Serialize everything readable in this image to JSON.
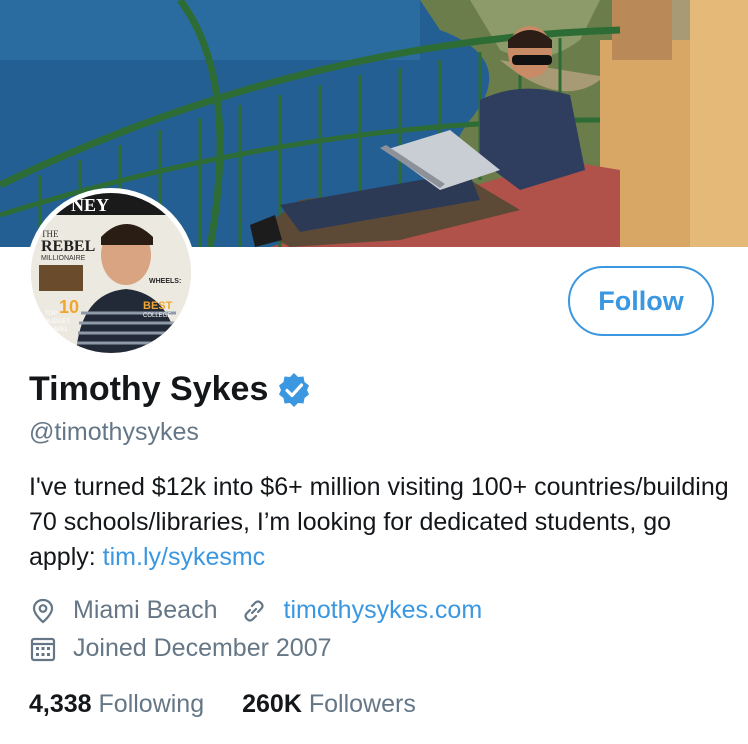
{
  "profile": {
    "name": "Timothy Sykes",
    "handle": "@timothysykes",
    "follow_label": "Follow",
    "bio_text": "I've turned $12k into $6+ million visiting 100+ countries/building 70 schools/libraries, I’m looking for dedicated students, go apply: ",
    "bio_link": "tim.ly/sykesmc",
    "location": "Miami Beach",
    "website": "timothysykes.com",
    "joined": "Joined December 2007",
    "following_count": "4,338",
    "following_label": "Following",
    "followers_count": "260K",
    "followers_label": "Followers"
  },
  "avatar_magazine": {
    "header": "NEY",
    "title_line1": "THE",
    "title_line2": "REBEL",
    "title_line3": "MILLIONAIRE",
    "side_text": "WHEELS:",
    "badge_big": "10",
    "badge_sub1": "TOP",
    "badge_sub2": "BUDGET",
    "badge_sub3": "TRAVEL",
    "badge_sub4": "TIPS",
    "best": "BEST",
    "best_sub": "COLLEGE"
  },
  "icons": {
    "verified": "verified-badge-icon",
    "location": "location-pin-icon",
    "link": "link-icon",
    "calendar": "calendar-icon"
  },
  "colors": {
    "accent": "#3a97e0",
    "text": "#14171a",
    "muted": "#657786"
  }
}
